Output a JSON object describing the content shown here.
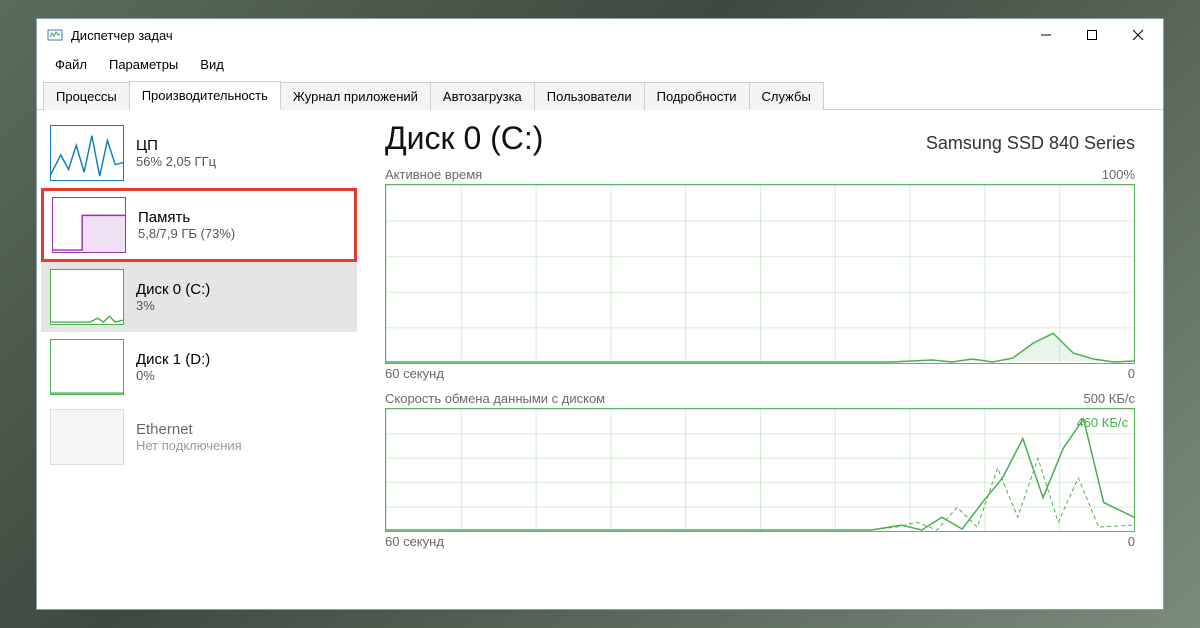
{
  "window": {
    "title": "Диспетчер задач"
  },
  "menu": {
    "file": "Файл",
    "options": "Параметры",
    "view": "Вид"
  },
  "tabs": {
    "processes": "Процессы",
    "performance": "Производительность",
    "app_history": "Журнал приложений",
    "startup": "Автозагрузка",
    "users": "Пользователи",
    "details": "Подробности",
    "services": "Службы"
  },
  "sidebar": {
    "cpu": {
      "title": "ЦП",
      "sub": "56% 2,05 ГГц"
    },
    "memory": {
      "title": "Память",
      "sub": "5,8/7,9 ГБ (73%)"
    },
    "disk0": {
      "title": "Диск 0 (C:)",
      "sub": "3%"
    },
    "disk1": {
      "title": "Диск 1 (D:)",
      "sub": "0%"
    },
    "ethernet": {
      "title": "Ethernet",
      "sub": "Нет подключения"
    }
  },
  "main": {
    "title": "Диск 0 (C:)",
    "model": "Samsung SSD 840 Series",
    "active_time_label": "Активное время",
    "active_time_max": "100%",
    "x_left": "60 секунд",
    "x_right": "0",
    "transfer_label": "Скорость обмена данными с диском",
    "transfer_max": "500 КБ/с",
    "transfer_annot": "460 КБ/с"
  },
  "chart_data": [
    {
      "type": "line",
      "title": "Активное время",
      "xlabel": "60 секунд → 0",
      "ylabel": "%",
      "ylim": [
        0,
        100
      ],
      "x": [
        0,
        5,
        10,
        15,
        20,
        25,
        30,
        35,
        40,
        45,
        50,
        55,
        60
      ],
      "values": [
        0,
        0,
        0,
        0,
        0,
        0,
        1,
        1,
        0,
        2,
        15,
        5,
        1
      ]
    },
    {
      "type": "line",
      "title": "Скорость обмена данными с диском",
      "xlabel": "60 секунд → 0",
      "ylabel": "КБ/с",
      "ylim": [
        0,
        500
      ],
      "series": [
        {
          "name": "read",
          "values": [
            0,
            0,
            0,
            0,
            0,
            0,
            10,
            5,
            0,
            50,
            250,
            460,
            80
          ]
        },
        {
          "name": "write",
          "values": [
            0,
            0,
            0,
            0,
            0,
            5,
            40,
            10,
            5,
            200,
            350,
            120,
            40
          ]
        }
      ],
      "x": [
        0,
        5,
        10,
        15,
        20,
        25,
        30,
        35,
        40,
        45,
        50,
        55,
        60
      ]
    }
  ],
  "colors": {
    "accent_green": "#4caf50",
    "accent_blue": "#117dbb",
    "accent_purple": "#9b2fae",
    "highlight_red": "#e33b2e"
  }
}
